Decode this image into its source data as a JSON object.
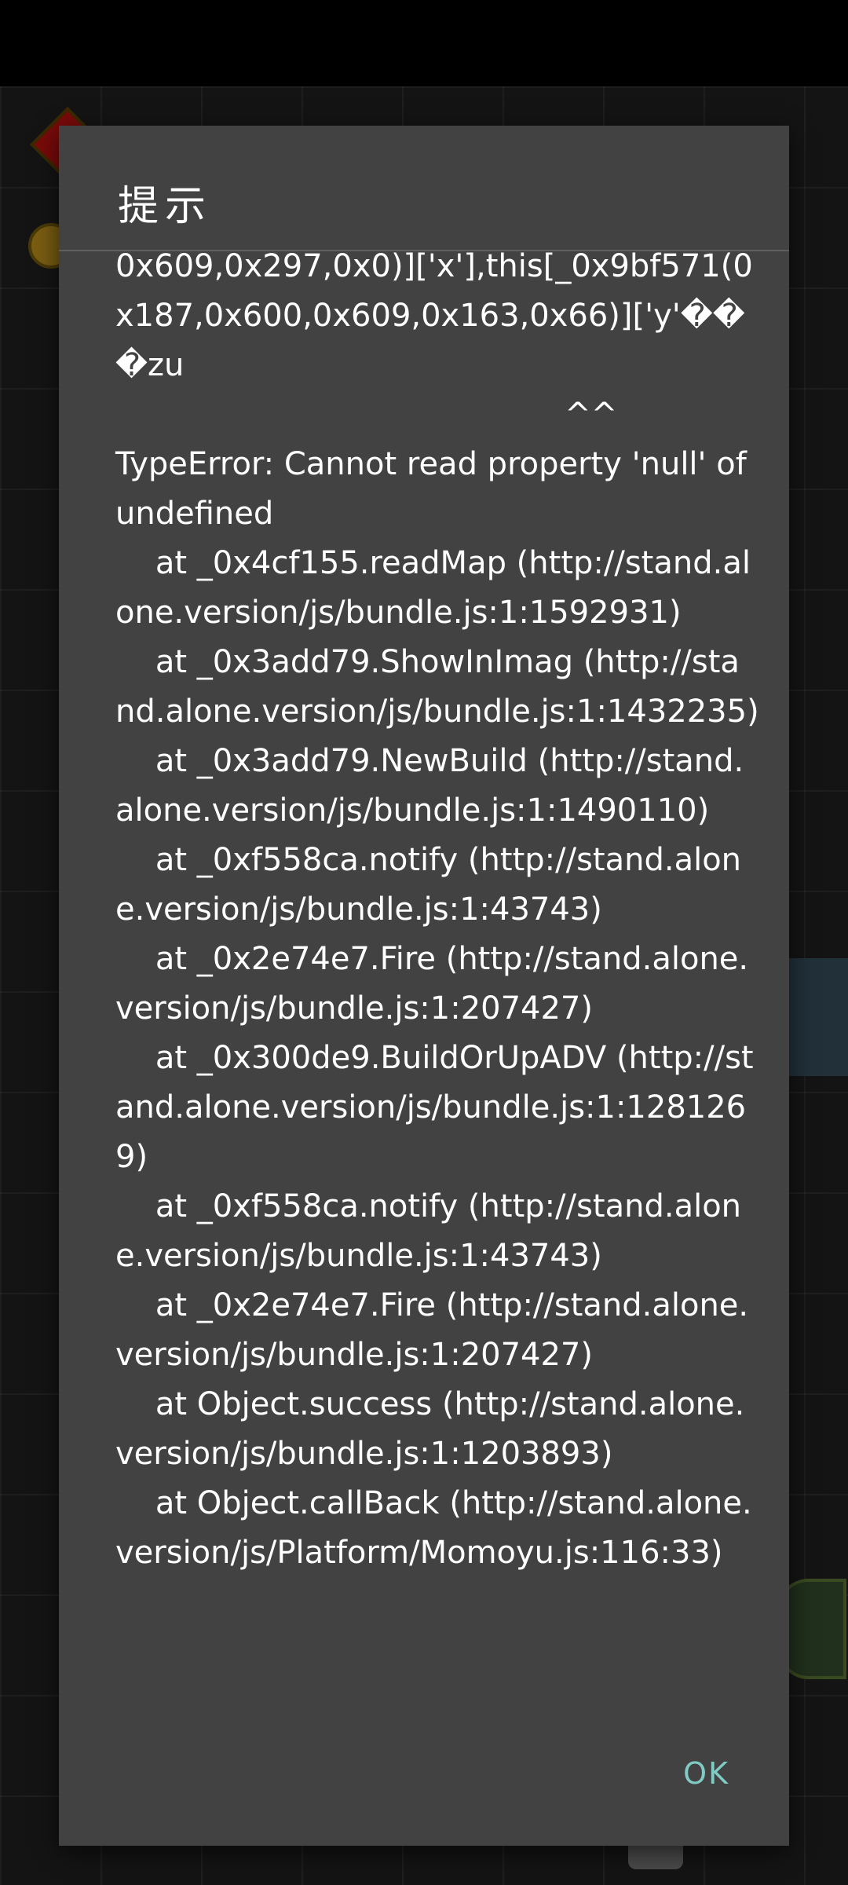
{
  "dialog": {
    "title": "提示",
    "message": "0x609,0x297,0x0)]['x'],this[_0x9bf571(0x187,0x600,0x609,0x163,0x66)]['y'���zu\n                                             ^^\nTypeError: Cannot read property 'null' of undefined\n    at _0x4cf155.readMap (http://stand.alone.version/js/bundle.js:1:1592931)\n    at _0x3add79.ShowInImag (http://stand.alone.version/js/bundle.js:1:1432235)\n    at _0x3add79.NewBuild (http://stand.alone.version/js/bundle.js:1:1490110)\n    at _0xf558ca.notify (http://stand.alone.version/js/bundle.js:1:43743)\n    at _0x2e74e7.Fire (http://stand.alone.version/js/bundle.js:1:207427)\n    at _0x300de9.BuildOrUpADV (http://stand.alone.version/js/bundle.js:1:1281269)\n    at _0xf558ca.notify (http://stand.alone.version/js/bundle.js:1:43743)\n    at _0x2e74e7.Fire (http://stand.alone.version/js/bundle.js:1:207427)\n    at Object.success (http://stand.alone.version/js/bundle.js:1:1203893)\n    at Object.callBack (http://stand.alone.version/js/Platform/Momoyu.js:116:33)",
    "ok_label": "OK"
  },
  "colors": {
    "dialog_bg": "#424242",
    "ok_accent": "#80cbc4",
    "text": "#ffffff"
  }
}
